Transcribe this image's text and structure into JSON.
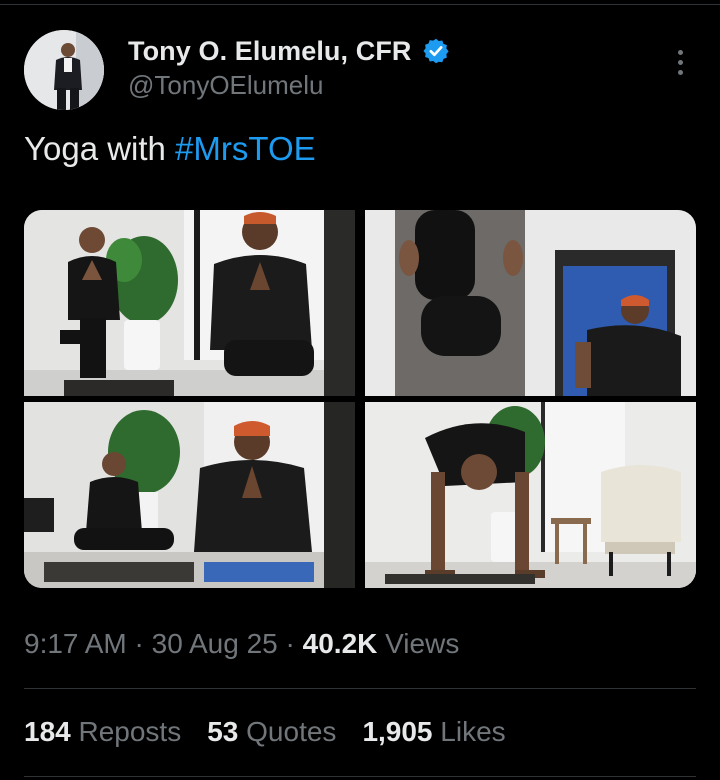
{
  "author": {
    "display_name": "Tony O. Elumelu, CFR",
    "handle": "@TonyOElumelu",
    "verified": true,
    "avatar_icon": "profile-photo",
    "verified_color": "#1d9bf0"
  },
  "tweet": {
    "text_prefix": "Yoga with ",
    "hashtag": "#MrsTOE",
    "hashtag_color": "#1d9bf0"
  },
  "media": {
    "photos": [
      {
        "id": "photo-1"
      },
      {
        "id": "photo-2"
      },
      {
        "id": "photo-3"
      },
      {
        "id": "photo-4"
      }
    ]
  },
  "meta": {
    "time": "9:17 AM",
    "separator": " · ",
    "date": "30 Aug 25",
    "views_count": "40.2K",
    "views_label": " Views"
  },
  "stats": {
    "reposts_count": "184",
    "reposts_label": " Reposts",
    "quotes_count": "53",
    "quotes_label": " Quotes",
    "likes_count": "1,905",
    "likes_label": " Likes"
  },
  "icons": {
    "more": "more-options-icon",
    "verified": "verified-badge-icon"
  }
}
